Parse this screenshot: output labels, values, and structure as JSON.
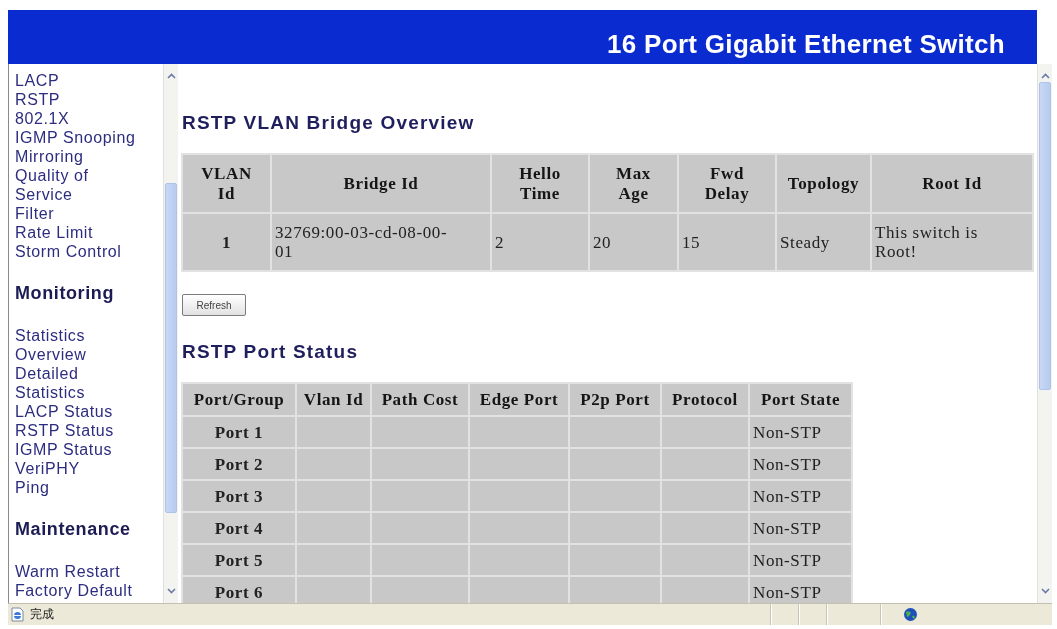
{
  "header": {
    "title": "16 Port Gigabit Ethernet Switch"
  },
  "sidebar": {
    "sections": [
      {
        "items": [
          "LACP",
          "RSTP",
          "802.1X",
          "IGMP Snooping",
          "Mirroring",
          "Quality of Service",
          "Filter",
          "Rate Limit",
          "Storm Control"
        ]
      },
      {
        "heading": "Monitoring",
        "items": [
          "Statistics Overview",
          "Detailed Statistics",
          "LACP Status",
          "RSTP Status",
          "IGMP Status",
          "VeriPHY",
          "Ping"
        ]
      },
      {
        "heading": "Maintenance",
        "items": [
          "Warm Restart",
          "Factory Default"
        ]
      }
    ]
  },
  "bridge_overview": {
    "title": "RSTP VLAN Bridge Overview",
    "columns": [
      "VLAN Id",
      "Bridge Id",
      "Hello Time",
      "Max Age",
      "Fwd Delay",
      "Topology",
      "Root Id"
    ],
    "rows": [
      [
        "1",
        "32769:00-03-cd-08-00-01",
        "2",
        "20",
        "15",
        "Steady",
        "This switch is Root!"
      ]
    ]
  },
  "refresh_button": {
    "label": "Refresh"
  },
  "port_status": {
    "title": "RSTP Port Status",
    "columns": [
      "Port/Group",
      "Vlan Id",
      "Path Cost",
      "Edge Port",
      "P2p Port",
      "Protocol",
      "Port State"
    ],
    "rows": [
      {
        "port": "Port 1",
        "port_state": "Non-STP"
      },
      {
        "port": "Port 2",
        "port_state": "Non-STP"
      },
      {
        "port": "Port 3",
        "port_state": "Non-STP"
      },
      {
        "port": "Port 4",
        "port_state": "Non-STP"
      },
      {
        "port": "Port 5",
        "port_state": "Non-STP"
      },
      {
        "port": "Port 6",
        "port_state": "Non-STP"
      }
    ]
  },
  "status_bar": {
    "text": "完成"
  }
}
